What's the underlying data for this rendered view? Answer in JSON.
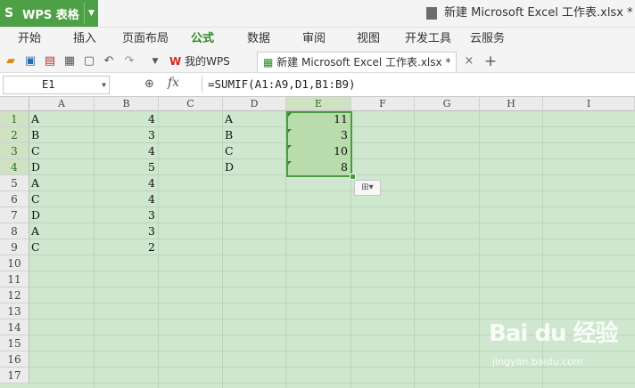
{
  "app": {
    "button_label": "WPS 表格",
    "document_title": "新建 Microsoft Excel 工作表.xlsx * - W"
  },
  "menu": [
    "开始",
    "插入",
    "页面布局",
    "公式",
    "数据",
    "审阅",
    "视图",
    "开发工具",
    "云服务"
  ],
  "tabs": {
    "home_tab": "我的WPS",
    "file_tab": "新建 Microsoft Excel 工作表.xlsx *",
    "close_glyph": "×",
    "add_glyph": "+"
  },
  "formula_bar": {
    "cell_ref": "E1",
    "fx_label": "fx",
    "formula": "=SUMIF(A1:A9,D1,B1:B9)"
  },
  "columns": [
    "A",
    "B",
    "C",
    "D",
    "E",
    "F",
    "G",
    "H",
    "I"
  ],
  "rows": [
    "1",
    "2",
    "3",
    "4",
    "5",
    "6",
    "7",
    "8",
    "9",
    "10",
    "11",
    "12",
    "13",
    "14",
    "15",
    "16",
    "17"
  ],
  "sheet": {
    "col_a": [
      "A",
      "B",
      "C",
      "D",
      "A",
      "C",
      "D",
      "A",
      "C"
    ],
    "col_b": [
      "4",
      "3",
      "4",
      "5",
      "4",
      "4",
      "3",
      "3",
      "2"
    ],
    "col_d": [
      "A",
      "B",
      "C",
      "D"
    ],
    "col_e": [
      "11",
      "3",
      "10",
      "8"
    ]
  },
  "watermark": {
    "main": "Bai du 经验",
    "sub": "jingyan.baidu.com"
  },
  "colors": {
    "accent": "#4da045",
    "sheet_background": "#cfe7cf",
    "selection_border": "#4b9a3e"
  }
}
